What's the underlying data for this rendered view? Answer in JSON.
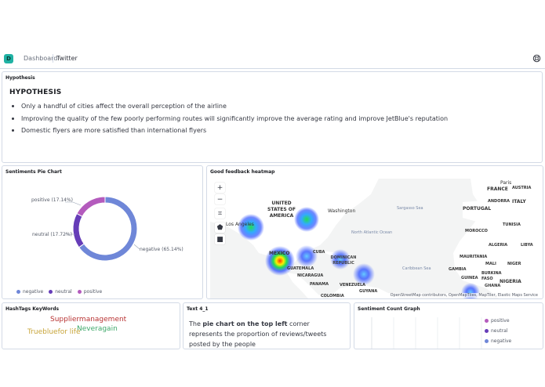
{
  "topbar": {
    "logo_letter": "D",
    "breadcrumbs": [
      "Dashboard",
      "Twitter"
    ],
    "help_icon": "help-icon"
  },
  "hypothesis": {
    "panel_title": "Hypothesis",
    "heading": "HYPOTHESIS",
    "items": [
      "Only a handful of cities affect the overall perception of the airline",
      "Improving the quality of the few poorly performing routes will significantly improve the average rating and improve JetBlue's reputation",
      "Domestic flyers are more satisfied than international flyers"
    ]
  },
  "pie": {
    "panel_title": "Sentiments Pie Chart",
    "labels": {
      "positive": "positive (17.14%)",
      "neutral": "neutral (17.72%)",
      "negative": "negative (65.14%)"
    },
    "legend": [
      "negative",
      "neutral",
      "positive"
    ]
  },
  "chart_data": {
    "type": "pie",
    "donut": true,
    "slices": [
      {
        "label": "negative",
        "value": 65.14,
        "color": "#6f87d8"
      },
      {
        "label": "neutral",
        "value": 17.72,
        "color": "#663db8"
      },
      {
        "label": "positive",
        "value": 17.14,
        "color": "#b45bbd"
      }
    ],
    "legend_position": "bottom-left"
  },
  "map": {
    "panel_title": "Good feedback heatmap",
    "attribution": "OpenStreetMap contributors, OpenMapTiles, MapTiler, Elastic Maps Service",
    "controls": [
      "zoom-in-icon",
      "zoom-out-icon",
      "crop-icon",
      "polygon-icon",
      "square-icon"
    ],
    "place_labels": [
      "UNITED STATES OF AMERICA",
      "Washington",
      "Los Angeles",
      "MEXICO",
      "CUBA",
      "DOMINICAN REPUBLIC",
      "GUATEMALA",
      "NICARAGUA",
      "PANAMA",
      "VENEZUELA",
      "COLOMBIA",
      "GUYANA",
      "Paris",
      "FRANCE",
      "AUSTRIA",
      "ANDORRA",
      "ITALY",
      "PORTUGAL",
      "MOROCCO",
      "TUNISIA",
      "ALGERIA",
      "LIBYA",
      "MAURITANIA",
      "MALI",
      "NIGER",
      "BURKINA FASO",
      "GHANA",
      "NIGERIA",
      "GUINEA",
      "GAMBIA",
      "Sargasso Sea",
      "Caribbean Sea",
      "North Atlantic Ocean"
    ]
  },
  "hashtags": {
    "panel_title": "HashTags KeyWords",
    "words": [
      {
        "text": "Suppliermanagement",
        "color": "#b83232"
      },
      {
        "text": "Neveragain",
        "color": "#3ea86a"
      },
      {
        "text": "Truebluefor life",
        "color": "#c8a53a"
      }
    ]
  },
  "text4": {
    "panel_title": "Text 4_1",
    "pre": "The ",
    "bold": "pie chart on the top left",
    "post": " corner represents the proportion of reviews/tweets posted by the people"
  },
  "sentiment_count": {
    "panel_title": "Sentiment Count Graph",
    "legend": [
      {
        "label": "positive",
        "color": "#b45bbd"
      },
      {
        "label": "neutral",
        "color": "#663db8"
      },
      {
        "label": "negative",
        "color": "#6f87d8"
      }
    ]
  }
}
